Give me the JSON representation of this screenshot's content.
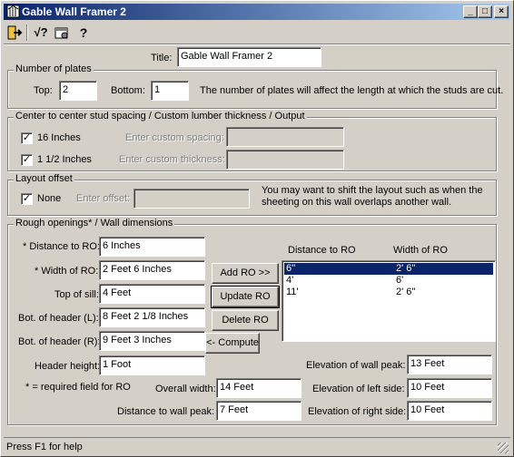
{
  "window": {
    "title": "Gable Wall Framer 2",
    "controls": {
      "minimize": "_",
      "maximize": "□",
      "close": "×"
    }
  },
  "toolbar": {
    "icons": [
      "exit-icon",
      "calculate-icon",
      "settings-icon",
      "help-icon"
    ],
    "calc_glyph": "√?",
    "help_glyph": "?"
  },
  "title_field": {
    "label": "Title:",
    "value": "Gable Wall Framer 2"
  },
  "plates": {
    "group_title": "Number of plates",
    "top_label": "Top:",
    "top_value": "2",
    "bottom_label": "Bottom:",
    "bottom_value": "1",
    "note": "The number of plates will affect the length at which the studs are cut."
  },
  "spacing": {
    "group_title": "Center to center stud spacing / Custom lumber thickness / Output",
    "check1_label": "16 Inches",
    "check1_checked": true,
    "custom_spacing_label": "Enter custom spacing:",
    "check2_label": "1 1/2 Inches",
    "check2_checked": true,
    "custom_thickness_label": "Enter custom thickness:"
  },
  "layout_offset": {
    "group_title": "Layout offset",
    "none_label": "None",
    "none_checked": true,
    "offset_label": "Enter offset:",
    "note": "You may want to shift the layout such as when the sheeting on this wall overlaps another wall."
  },
  "rough_openings": {
    "group_title": "Rough openings* / Wall dimensions",
    "distance_label": "* Distance to RO:",
    "distance_value": "6 Inches",
    "width_label": "* Width of RO:",
    "width_value": "2 Feet 6 Inches",
    "sill_label": "Top of sill:",
    "sill_value": "4 Feet",
    "header_l_label": "Bot. of header (L):",
    "header_l_value": "8 Feet 2 1/8 Inches",
    "header_r_label": "Bot. of header (R):",
    "header_r_value": "9 Feet 3 Inches",
    "header_height_label": "Header height:",
    "header_height_value": "1 Foot",
    "required_note": "* = required field for RO",
    "buttons": {
      "add": "Add RO >>",
      "update": "Update RO",
      "delete": "Delete RO",
      "compute": "<- Compute"
    },
    "list_headers": {
      "distance": "Distance to RO",
      "width": "Width of RO"
    },
    "list_rows": [
      {
        "distance": "6''",
        "width": "2' 6''",
        "selected": true
      },
      {
        "distance": "4'",
        "width": "6'",
        "selected": false
      },
      {
        "distance": "11'",
        "width": "2' 6''",
        "selected": false
      }
    ]
  },
  "wall": {
    "overall_width_label": "Overall width:",
    "overall_width_value": "14 Feet",
    "distance_peak_label": "Distance to wall peak:",
    "distance_peak_value": "7 Feet",
    "elev_peak_label": "Elevation of wall peak:",
    "elev_peak_value": "13 Feet",
    "elev_left_label": "Elevation of left side:",
    "elev_left_value": "10 Feet",
    "elev_right_label": "Elevation of right side:",
    "elev_right_value": "10 Feet"
  },
  "status": {
    "text": "Press F1 for help"
  },
  "colors": {
    "face": "#d4d0c8",
    "title_start": "#0a246a",
    "title_end": "#a6caf0",
    "selection": "#0a246a"
  }
}
